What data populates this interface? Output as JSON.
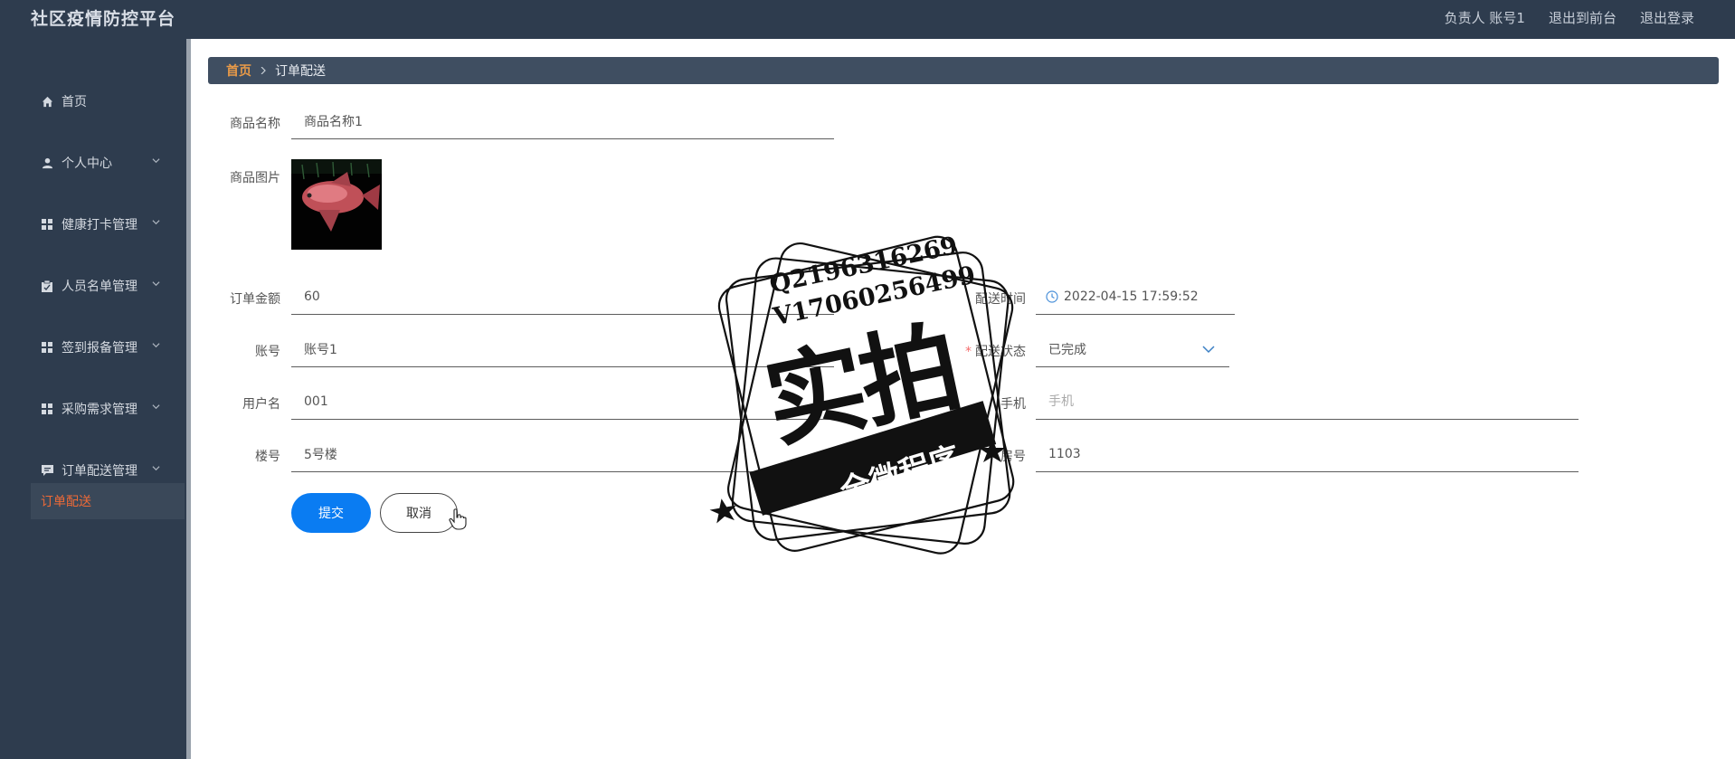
{
  "header": {
    "app_title": "社区疫情防控平台",
    "user_label": "负责人  账号1",
    "to_frontend": "退出到前台",
    "logout": "退出登录"
  },
  "sidebar": {
    "items": [
      {
        "label": "首页",
        "icon": "home-icon",
        "has_children": false
      },
      {
        "label": "个人中心",
        "icon": "user-icon",
        "has_children": true
      },
      {
        "label": "健康打卡管理",
        "icon": "grid-icon",
        "has_children": true
      },
      {
        "label": "人员名单管理",
        "icon": "clipboard-icon",
        "has_children": true
      },
      {
        "label": "签到报备管理",
        "icon": "grid-icon",
        "has_children": true
      },
      {
        "label": "采购需求管理",
        "icon": "grid-icon",
        "has_children": true
      },
      {
        "label": "订单配送管理",
        "icon": "chat-icon",
        "has_children": true
      }
    ],
    "active_sub": "订单配送"
  },
  "breadcrumb": {
    "home": "首页",
    "current": "订单配送"
  },
  "form": {
    "product_name_label": "商品名称",
    "product_name_value": "商品名称1",
    "product_image_label": "商品图片",
    "order_amount_label": "订单金额",
    "order_amount_value": "60",
    "delivery_time_label": "配送时间",
    "delivery_time_value": "2022-04-15 17:59:52",
    "account_label": "账号",
    "account_value": "账号1",
    "delivery_status_label": "配送状态",
    "delivery_status_value": "已完成",
    "username_label": "用户名",
    "username_value": "001",
    "phone_label": "手机",
    "phone_placeholder": "手机",
    "building_label": "楼号",
    "building_value": "5号楼",
    "room_label": "房号",
    "room_value": "1103",
    "submit_label": "提交",
    "cancel_label": "取消"
  },
  "watermark": {
    "line1": "Q2196316269",
    "line2": "V17060256499",
    "main": "实拍",
    "banner": "全微程序"
  },
  "colors": {
    "nav_bg": "#2e3c4e",
    "breadcrumb_bg": "#3f4e61",
    "accent_orange": "#ee6a37",
    "primary_blue": "#0a7cf2"
  }
}
